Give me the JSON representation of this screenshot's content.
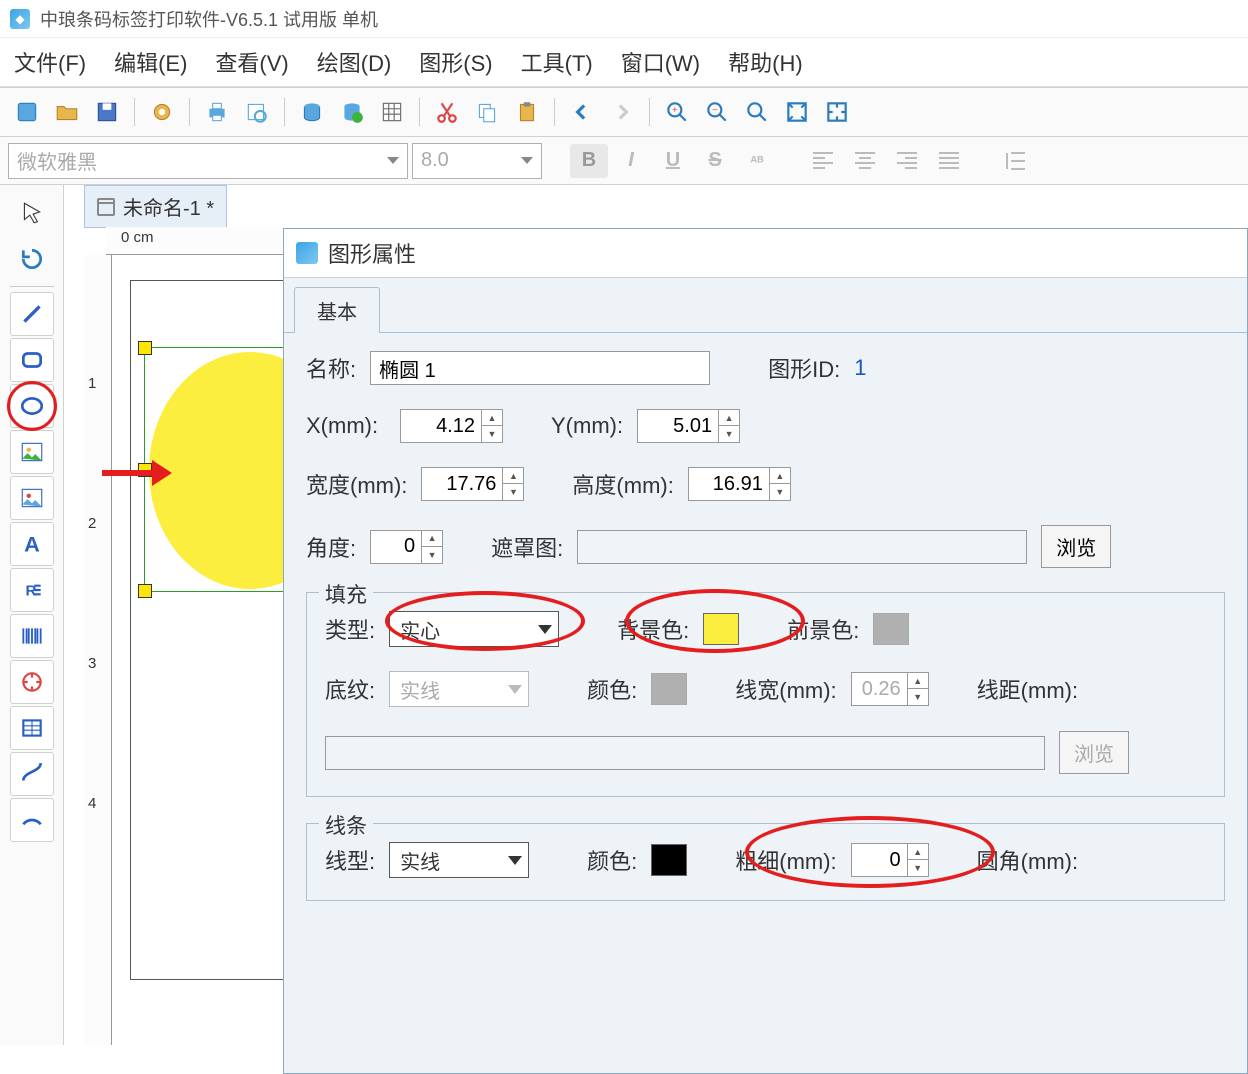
{
  "titlebar": {
    "text": "中琅条码标签打印软件-V6.5.1 试用版 单机"
  },
  "menu": {
    "file": "文件(F)",
    "edit": "编辑(E)",
    "view": "查看(V)",
    "draw": "绘图(D)",
    "shape": "图形(S)",
    "tools": "工具(T)",
    "window": "窗口(W)",
    "help": "帮助(H)"
  },
  "font": {
    "name_placeholder": "微软雅黑",
    "size_placeholder": "8.0"
  },
  "doc_tab": "未命名-1 *",
  "ruler": {
    "zero": "0 cm",
    "v1": "1",
    "v2": "2",
    "v3": "3",
    "v4": "4"
  },
  "dialog": {
    "title": "图形属性",
    "tab_basic": "基本",
    "name_lbl": "名称:",
    "name_val": "椭圆 1",
    "id_lbl": "图形ID:",
    "id_val": "1",
    "x_lbl": "X(mm):",
    "x_val": "4.12",
    "y_lbl": "Y(mm):",
    "y_val": "5.01",
    "w_lbl": "宽度(mm):",
    "w_val": "17.76",
    "h_lbl": "高度(mm):",
    "h_val": "16.91",
    "angle_lbl": "角度:",
    "angle_val": "0",
    "mask_lbl": "遮罩图:",
    "browse": "浏览",
    "fill": {
      "legend": "填充",
      "type_lbl": "类型:",
      "type_val": "实心",
      "bg_lbl": "背景色:",
      "fg_lbl": "前景色:",
      "pattern_lbl": "底纹:",
      "pattern_val": "实线",
      "color_lbl": "颜色:",
      "lw_lbl": "线宽(mm):",
      "lw_val": "0.26",
      "ld_lbl": "线距(mm):"
    },
    "line": {
      "legend": "线条",
      "type_lbl": "线型:",
      "type_val": "实线",
      "color_lbl": "颜色:",
      "thick_lbl": "粗细(mm):",
      "thick_val": "0",
      "radius_lbl": "圆角(mm):"
    }
  },
  "colors": {
    "bg_swatch": "#fcee3f",
    "fg_swatch": "#b0b0b0",
    "pattern_swatch": "#b0b0b0",
    "line_swatch": "#000000"
  }
}
